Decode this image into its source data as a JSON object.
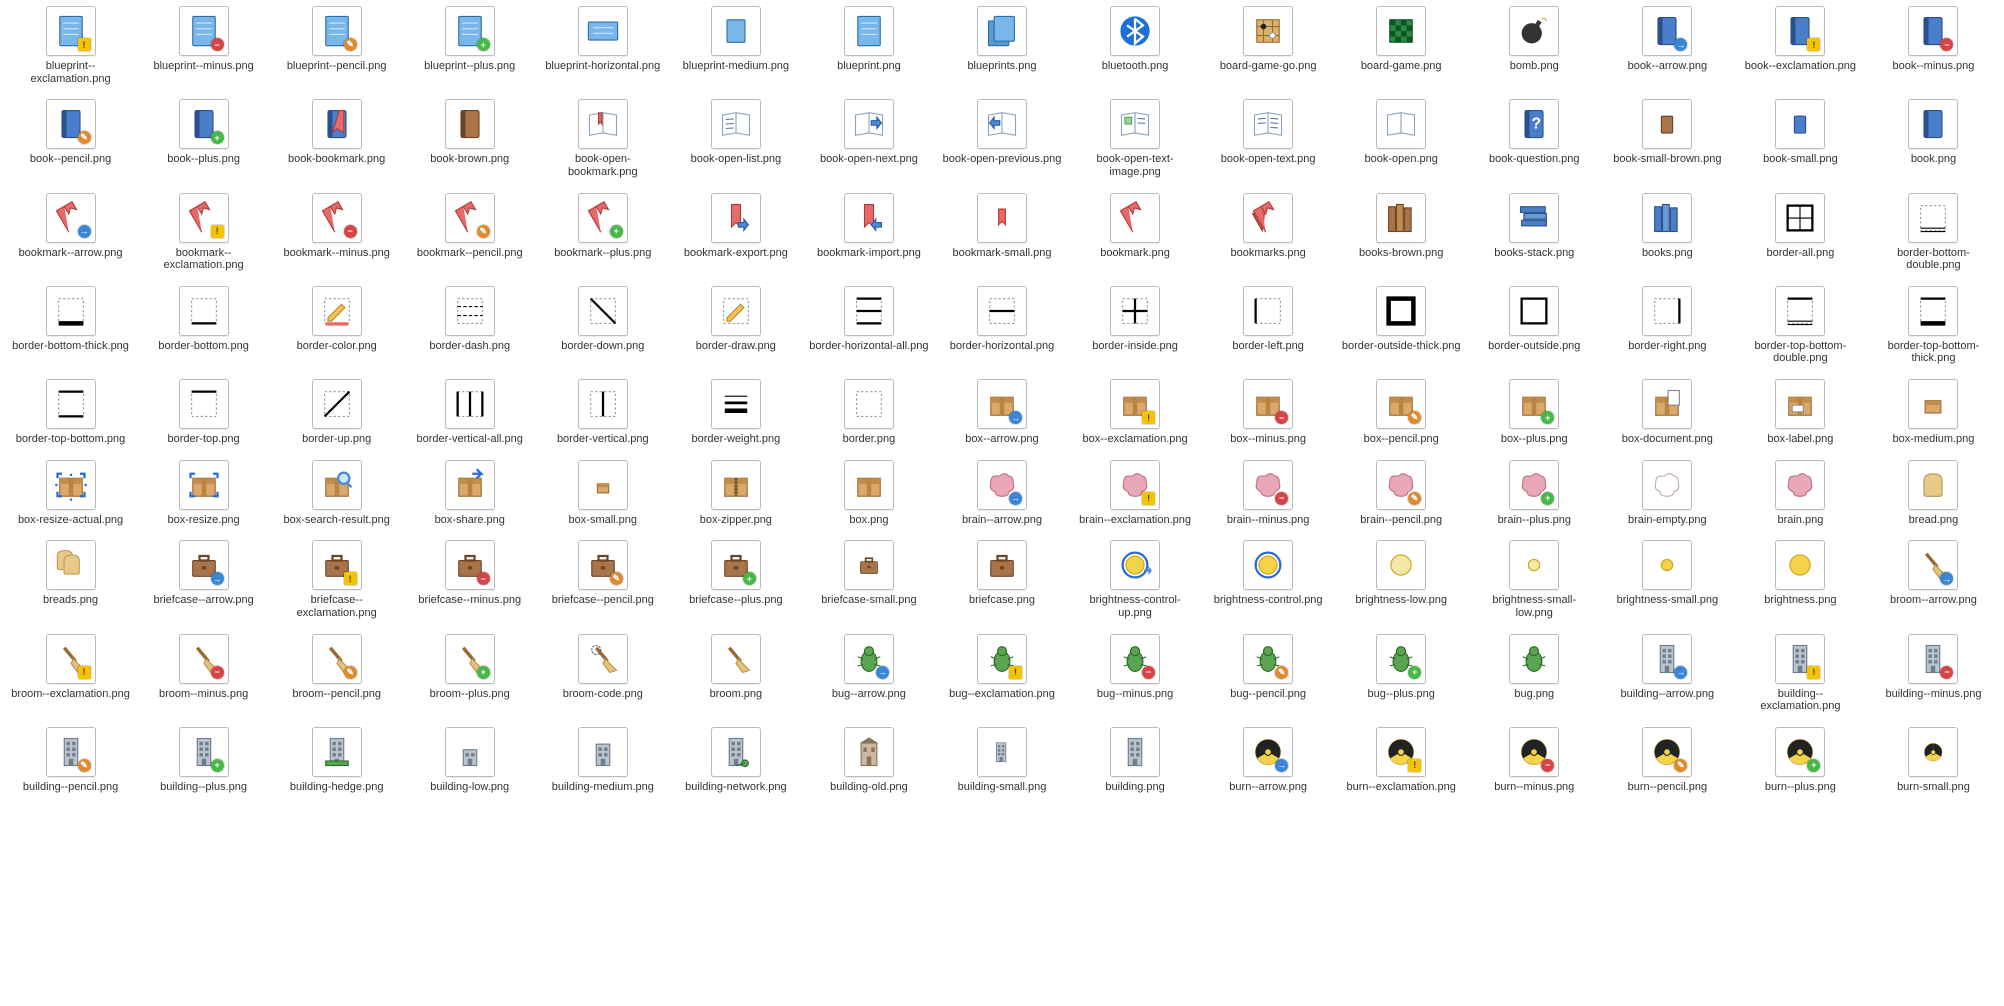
{
  "items": [
    {
      "label": "blueprint--exclamation.png",
      "icon": "blueprint",
      "badge": "excl"
    },
    {
      "label": "blueprint--minus.png",
      "icon": "blueprint",
      "badge": "minus"
    },
    {
      "label": "blueprint--pencil.png",
      "icon": "blueprint",
      "badge": "pencil"
    },
    {
      "label": "blueprint--plus.png",
      "icon": "blueprint",
      "badge": "plus"
    },
    {
      "label": "blueprint-horizontal.png",
      "icon": "blueprint-horizontal"
    },
    {
      "label": "blueprint-medium.png",
      "icon": "blueprint-medium"
    },
    {
      "label": "blueprint.png",
      "icon": "blueprint"
    },
    {
      "label": "blueprints.png",
      "icon": "blueprints"
    },
    {
      "label": "bluetooth.png",
      "icon": "bluetooth"
    },
    {
      "label": "board-game-go.png",
      "icon": "board-game-go"
    },
    {
      "label": "board-game.png",
      "icon": "board-game"
    },
    {
      "label": "bomb.png",
      "icon": "bomb"
    },
    {
      "label": "book--arrow.png",
      "icon": "book",
      "badge": "arrow"
    },
    {
      "label": "book--exclamation.png",
      "icon": "book",
      "badge": "excl"
    },
    {
      "label": "book--minus.png",
      "icon": "book",
      "badge": "minus"
    },
    {
      "label": "book--pencil.png",
      "icon": "book",
      "badge": "pencil"
    },
    {
      "label": "book--plus.png",
      "icon": "book",
      "badge": "plus"
    },
    {
      "label": "book-bookmark.png",
      "icon": "book-bookmark"
    },
    {
      "label": "book-brown.png",
      "icon": "book-brown"
    },
    {
      "label": "book-open-bookmark.png",
      "icon": "book-open-bookmark"
    },
    {
      "label": "book-open-list.png",
      "icon": "book-open-list"
    },
    {
      "label": "book-open-next.png",
      "icon": "book-open-next"
    },
    {
      "label": "book-open-previous.png",
      "icon": "book-open-previous"
    },
    {
      "label": "book-open-text-image.png",
      "icon": "book-open-text-image"
    },
    {
      "label": "book-open-text.png",
      "icon": "book-open-text"
    },
    {
      "label": "book-open.png",
      "icon": "book-open"
    },
    {
      "label": "book-question.png",
      "icon": "book-question"
    },
    {
      "label": "book-small-brown.png",
      "icon": "book-small-brown"
    },
    {
      "label": "book-small.png",
      "icon": "book-small"
    },
    {
      "label": "book.png",
      "icon": "book"
    },
    {
      "label": "bookmark--arrow.png",
      "icon": "bookmark",
      "badge": "arrow"
    },
    {
      "label": "bookmark--exclamation.png",
      "icon": "bookmark",
      "badge": "excl"
    },
    {
      "label": "bookmark--minus.png",
      "icon": "bookmark",
      "badge": "minus"
    },
    {
      "label": "bookmark--pencil.png",
      "icon": "bookmark",
      "badge": "pencil"
    },
    {
      "label": "bookmark--plus.png",
      "icon": "bookmark",
      "badge": "plus"
    },
    {
      "label": "bookmark-export.png",
      "icon": "bookmark-export"
    },
    {
      "label": "bookmark-import.png",
      "icon": "bookmark-import"
    },
    {
      "label": "bookmark-small.png",
      "icon": "bookmark-small"
    },
    {
      "label": "bookmark.png",
      "icon": "bookmark"
    },
    {
      "label": "bookmarks.png",
      "icon": "bookmarks"
    },
    {
      "label": "books-brown.png",
      "icon": "books-brown"
    },
    {
      "label": "books-stack.png",
      "icon": "books-stack"
    },
    {
      "label": "books.png",
      "icon": "books"
    },
    {
      "label": "border-all.png",
      "icon": "border-all"
    },
    {
      "label": "border-bottom-double.png",
      "icon": "border-bottom-double"
    },
    {
      "label": "border-bottom-thick.png",
      "icon": "border-bottom-thick"
    },
    {
      "label": "border-bottom.png",
      "icon": "border-bottom"
    },
    {
      "label": "border-color.png",
      "icon": "border-color"
    },
    {
      "label": "border-dash.png",
      "icon": "border-dash"
    },
    {
      "label": "border-down.png",
      "icon": "border-down"
    },
    {
      "label": "border-draw.png",
      "icon": "border-draw"
    },
    {
      "label": "border-horizontal-all.png",
      "icon": "border-horizontal-all"
    },
    {
      "label": "border-horizontal.png",
      "icon": "border-horizontal"
    },
    {
      "label": "border-inside.png",
      "icon": "border-inside"
    },
    {
      "label": "border-left.png",
      "icon": "border-left"
    },
    {
      "label": "border-outside-thick.png",
      "icon": "border-outside-thick"
    },
    {
      "label": "border-outside.png",
      "icon": "border-outside"
    },
    {
      "label": "border-right.png",
      "icon": "border-right"
    },
    {
      "label": "border-top-bottom-double.png",
      "icon": "border-top-bottom-double"
    },
    {
      "label": "border-top-bottom-thick.png",
      "icon": "border-top-bottom-thick"
    },
    {
      "label": "border-top-bottom.png",
      "icon": "border-top-bottom"
    },
    {
      "label": "border-top.png",
      "icon": "border-top"
    },
    {
      "label": "border-up.png",
      "icon": "border-up"
    },
    {
      "label": "border-vertical-all.png",
      "icon": "border-vertical-all"
    },
    {
      "label": "border-vertical.png",
      "icon": "border-vertical"
    },
    {
      "label": "border-weight.png",
      "icon": "border-weight"
    },
    {
      "label": "border.png",
      "icon": "border"
    },
    {
      "label": "box--arrow.png",
      "icon": "box",
      "badge": "arrow"
    },
    {
      "label": "box--exclamation.png",
      "icon": "box",
      "badge": "excl"
    },
    {
      "label": "box--minus.png",
      "icon": "box",
      "badge": "minus"
    },
    {
      "label": "box--pencil.png",
      "icon": "box",
      "badge": "pencil"
    },
    {
      "label": "box--plus.png",
      "icon": "box",
      "badge": "plus"
    },
    {
      "label": "box-document.png",
      "icon": "box-document"
    },
    {
      "label": "box-label.png",
      "icon": "box-label"
    },
    {
      "label": "box-medium.png",
      "icon": "box-medium"
    },
    {
      "label": "box-resize-actual.png",
      "icon": "box-resize-actual"
    },
    {
      "label": "box-resize.png",
      "icon": "box-resize"
    },
    {
      "label": "box-search-result.png",
      "icon": "box-search-result"
    },
    {
      "label": "box-share.png",
      "icon": "box-share"
    },
    {
      "label": "box-small.png",
      "icon": "box-small"
    },
    {
      "label": "box-zipper.png",
      "icon": "box-zipper"
    },
    {
      "label": "box.png",
      "icon": "box"
    },
    {
      "label": "brain--arrow.png",
      "icon": "brain",
      "badge": "arrow"
    },
    {
      "label": "brain--exclamation.png",
      "icon": "brain",
      "badge": "excl"
    },
    {
      "label": "brain--minus.png",
      "icon": "brain",
      "badge": "minus"
    },
    {
      "label": "brain--pencil.png",
      "icon": "brain",
      "badge": "pencil"
    },
    {
      "label": "brain--plus.png",
      "icon": "brain",
      "badge": "plus"
    },
    {
      "label": "brain-empty.png",
      "icon": "brain-empty"
    },
    {
      "label": "brain.png",
      "icon": "brain"
    },
    {
      "label": "bread.png",
      "icon": "bread"
    },
    {
      "label": "breads.png",
      "icon": "breads"
    },
    {
      "label": "briefcase--arrow.png",
      "icon": "briefcase",
      "badge": "arrow"
    },
    {
      "label": "briefcase--exclamation.png",
      "icon": "briefcase",
      "badge": "excl"
    },
    {
      "label": "briefcase--minus.png",
      "icon": "briefcase",
      "badge": "minus"
    },
    {
      "label": "briefcase--pencil.png",
      "icon": "briefcase",
      "badge": "pencil"
    },
    {
      "label": "briefcase--plus.png",
      "icon": "briefcase",
      "badge": "plus"
    },
    {
      "label": "briefcase-small.png",
      "icon": "briefcase-small"
    },
    {
      "label": "briefcase.png",
      "icon": "briefcase"
    },
    {
      "label": "brightness-control-up.png",
      "icon": "brightness-control-up"
    },
    {
      "label": "brightness-control.png",
      "icon": "brightness-control"
    },
    {
      "label": "brightness-low.png",
      "icon": "brightness-low"
    },
    {
      "label": "brightness-small-low.png",
      "icon": "brightness-small-low"
    },
    {
      "label": "brightness-small.png",
      "icon": "brightness-small"
    },
    {
      "label": "brightness.png",
      "icon": "brightness"
    },
    {
      "label": "broom--arrow.png",
      "icon": "broom",
      "badge": "arrow"
    },
    {
      "label": "broom--exclamation.png",
      "icon": "broom",
      "badge": "excl"
    },
    {
      "label": "broom--minus.png",
      "icon": "broom",
      "badge": "minus"
    },
    {
      "label": "broom--pencil.png",
      "icon": "broom",
      "badge": "pencil"
    },
    {
      "label": "broom--plus.png",
      "icon": "broom",
      "badge": "plus"
    },
    {
      "label": "broom-code.png",
      "icon": "broom-code"
    },
    {
      "label": "broom.png",
      "icon": "broom"
    },
    {
      "label": "bug--arrow.png",
      "icon": "bug",
      "badge": "arrow"
    },
    {
      "label": "bug--exclamation.png",
      "icon": "bug",
      "badge": "excl"
    },
    {
      "label": "bug--minus.png",
      "icon": "bug",
      "badge": "minus"
    },
    {
      "label": "bug--pencil.png",
      "icon": "bug",
      "badge": "pencil"
    },
    {
      "label": "bug--plus.png",
      "icon": "bug",
      "badge": "plus"
    },
    {
      "label": "bug.png",
      "icon": "bug"
    },
    {
      "label": "building--arrow.png",
      "icon": "building",
      "badge": "arrow"
    },
    {
      "label": "building--exclamation.png",
      "icon": "building",
      "badge": "excl"
    },
    {
      "label": "building--minus.png",
      "icon": "building",
      "badge": "minus"
    },
    {
      "label": "building--pencil.png",
      "icon": "building",
      "badge": "pencil"
    },
    {
      "label": "building--plus.png",
      "icon": "building",
      "badge": "plus"
    },
    {
      "label": "building-hedge.png",
      "icon": "building-hedge"
    },
    {
      "label": "building-low.png",
      "icon": "building-low"
    },
    {
      "label": "building-medium.png",
      "icon": "building-medium"
    },
    {
      "label": "building-network.png",
      "icon": "building-network"
    },
    {
      "label": "building-old.png",
      "icon": "building-old"
    },
    {
      "label": "building-small.png",
      "icon": "building-small"
    },
    {
      "label": "building.png",
      "icon": "building"
    },
    {
      "label": "burn--arrow.png",
      "icon": "burn",
      "badge": "arrow"
    },
    {
      "label": "burn--exclamation.png",
      "icon": "burn",
      "badge": "excl"
    },
    {
      "label": "burn--minus.png",
      "icon": "burn",
      "badge": "minus"
    },
    {
      "label": "burn--pencil.png",
      "icon": "burn",
      "badge": "pencil"
    },
    {
      "label": "burn--plus.png",
      "icon": "burn",
      "badge": "plus"
    },
    {
      "label": "burn-small.png",
      "icon": "burn-small"
    }
  ]
}
